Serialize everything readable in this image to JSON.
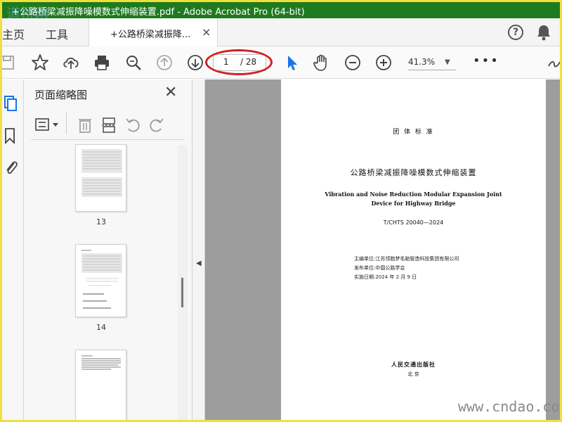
{
  "window": {
    "title": "+公路桥梁减振降噪模数式伸缩装置.pdf - Adobe Acrobat Pro (64-bit)",
    "watermark_top": "道桥网"
  },
  "menu": {
    "home": "主页",
    "tools": "工具"
  },
  "tab": {
    "label": "+公路桥梁减振降...",
    "close": "×"
  },
  "header_icons": [
    "help-icon",
    "bell-icon"
  ],
  "toolbar": {
    "icons": [
      "save-icon",
      "star-icon",
      "upload-icon",
      "print-icon",
      "zoom-search-icon",
      "page-up-icon",
      "page-down-icon",
      "select-cursor-icon",
      "hand-icon",
      "zoom-out-icon",
      "zoom-in-icon",
      "more-icon",
      "sign-icon"
    ],
    "current_page": "1",
    "total_pages": "/ 28",
    "zoom": "41.3%",
    "more": "•••"
  },
  "panel": {
    "title": "页面缩略图",
    "close": "✕",
    "thumbnails": [
      {
        "number": "13"
      },
      {
        "number": "14"
      }
    ]
  },
  "document": {
    "standard_type": "团 体 标 准",
    "title_cn": "公路桥梁减振降噪模数式伸缩装置",
    "title_en_1": "Vibration and Noise Reduction Modular Expansion Joint",
    "title_en_2": "Device for Highway Bridge",
    "code": "T/CHTS 20040—2024",
    "editor": "主编单位:江苏领跑梦毛勒智造科技集团有限公司",
    "publisher": "发布单位:中国公路学会",
    "effective_date": "实施日期:2024 年 2 月 9 日",
    "press": "人民交通出版社",
    "city": "北 京"
  },
  "watermark_bottom": "www.cndao.co",
  "colors": {
    "title_bar": "#1e7a1e",
    "frame": "#f0e03c",
    "highlight_ellipse": "#d42020",
    "select_cursor": "#1a73e8"
  }
}
